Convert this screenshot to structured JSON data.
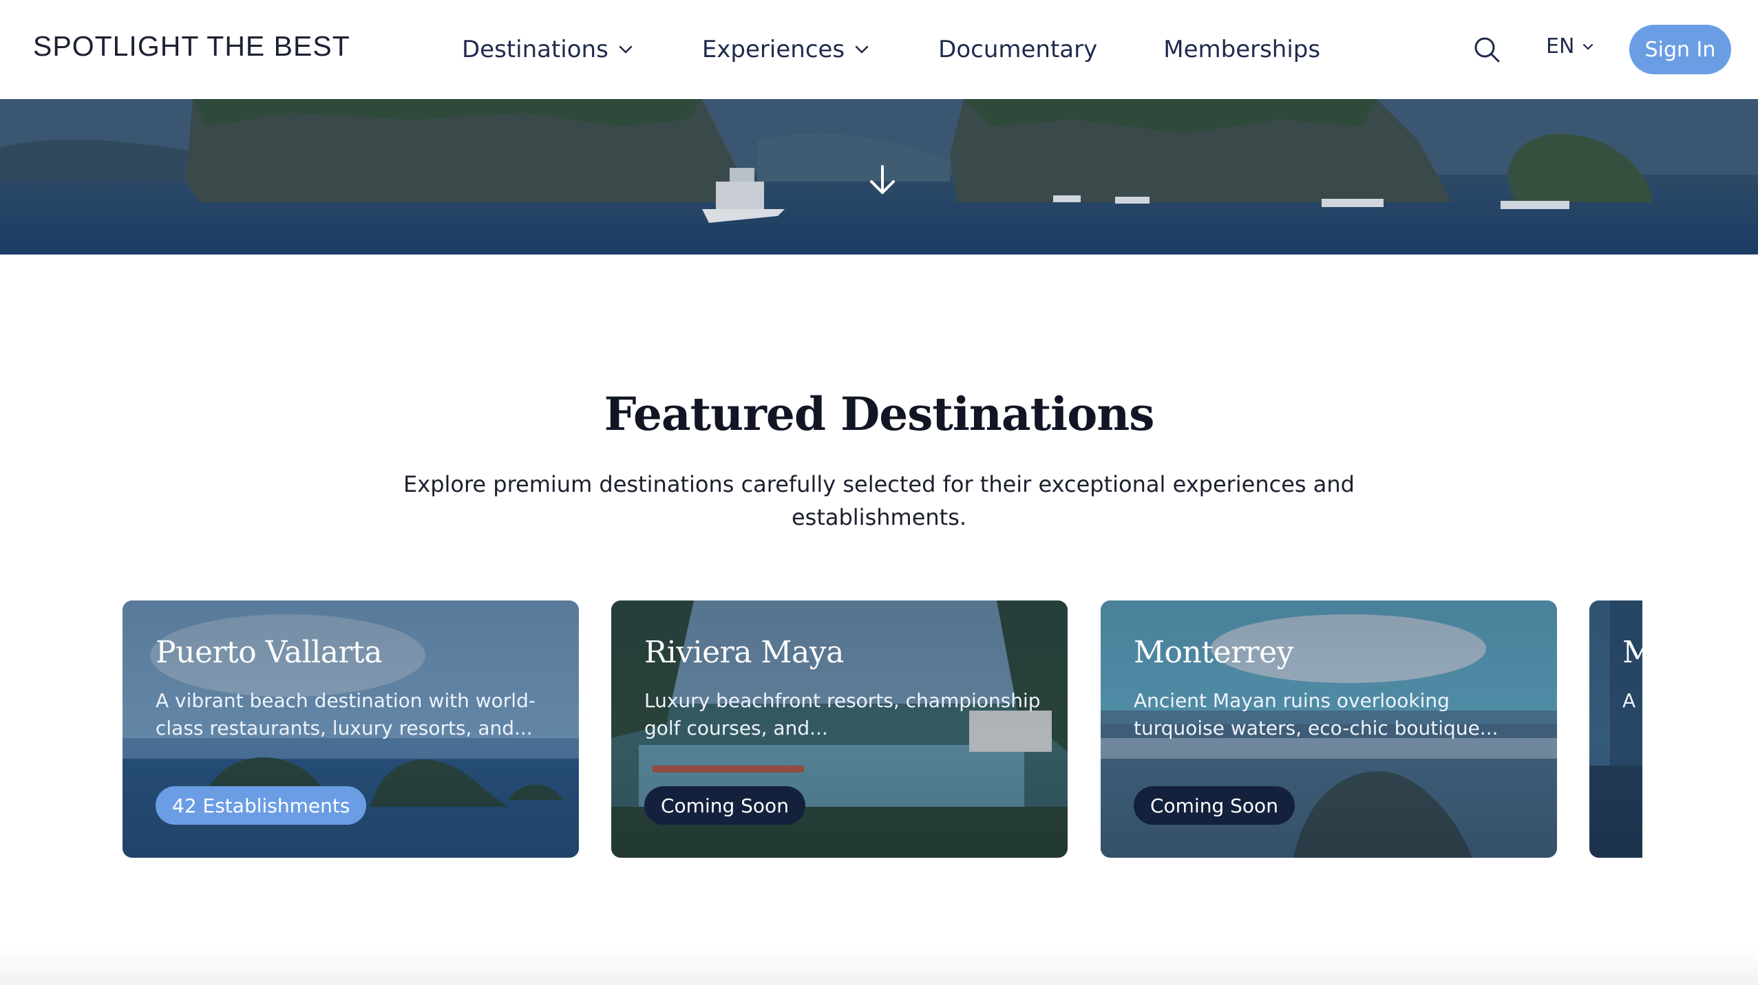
{
  "header": {
    "logo": "SPOTLIGHT THE BEST",
    "nav": [
      {
        "label": "Destinations",
        "has_dropdown": true
      },
      {
        "label": "Experiences",
        "has_dropdown": true
      },
      {
        "label": "Documentary",
        "has_dropdown": false
      },
      {
        "label": "Memberships",
        "has_dropdown": false
      }
    ],
    "search_icon": "search-icon",
    "language": "EN",
    "sign_in": "Sign In",
    "accent_color": "#6b9de4"
  },
  "hero": {
    "scroll_icon": "arrow-down-icon"
  },
  "featured": {
    "title": "Featured Destinations",
    "description": "Explore premium destinations carefully selected for their exceptional experiences and establishments.",
    "cards": [
      {
        "title": "Puerto Vallarta",
        "description": "A vibrant beach destination with world-class restaurants, luxury resorts, and...",
        "badge": "42 Establishments"
      },
      {
        "title": "Riviera Maya",
        "description": "Luxury beachfront resorts, championship golf courses, and...",
        "badge": "Coming Soon"
      },
      {
        "title": "Monterrey",
        "description": "Ancient Mayan ruins overlooking turquoise waters, eco-chic boutique...",
        "badge": "Coming Soon"
      },
      {
        "title": "M",
        "description": "A",
        "badge": ""
      }
    ]
  }
}
